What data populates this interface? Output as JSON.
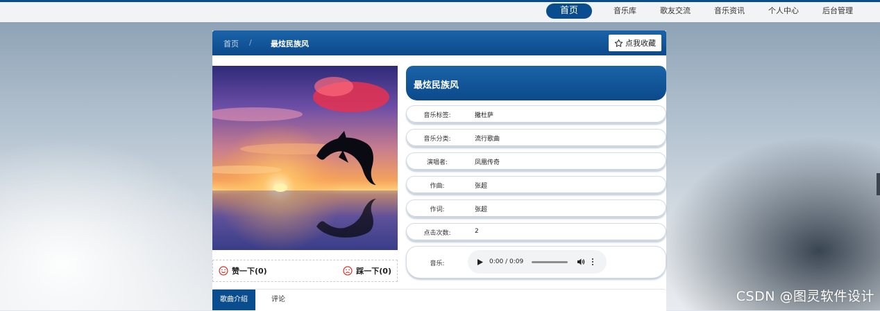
{
  "nav": {
    "items": [
      {
        "label": "首页",
        "active": true
      },
      {
        "label": "音乐库",
        "active": false
      },
      {
        "label": "歌友交流",
        "active": false
      },
      {
        "label": "音乐资讯",
        "active": false
      },
      {
        "label": "个人中心",
        "active": false
      },
      {
        "label": "后台管理",
        "active": false
      }
    ]
  },
  "breadcrumb": {
    "home": "首页",
    "separator": "/",
    "current": "最炫民族风"
  },
  "favorite_button": {
    "label": "点我收藏",
    "icon": "star-outline-icon"
  },
  "song": {
    "title": "最炫民族风",
    "cover_icon": "sunset-dolphin-image",
    "details": [
      {
        "label": "音乐标签:",
        "value": "撒杜萨"
      },
      {
        "label": "音乐分类:",
        "value": "流行歌曲"
      },
      {
        "label": "演唱者:",
        "value": "凤凰传奇"
      },
      {
        "label": "作曲:",
        "value": "张超"
      },
      {
        "label": "作词:",
        "value": "张超"
      },
      {
        "label": "点击次数:",
        "value": "2"
      }
    ],
    "music_label": "音乐:"
  },
  "player": {
    "time": "0:00 / 0:09",
    "progress": 0.0
  },
  "votes": {
    "like_label": "赞一下(0)",
    "dislike_label": "踩一下(0)"
  },
  "tabs": [
    {
      "label": "歌曲介绍",
      "active": true
    },
    {
      "label": "评论",
      "active": false
    }
  ],
  "watermark": "CSDN @图灵软件设计",
  "colors": {
    "primary": "#0a4d8f",
    "header_gradient_top": "#1b63a8",
    "vote_icon": "#d9342b"
  }
}
